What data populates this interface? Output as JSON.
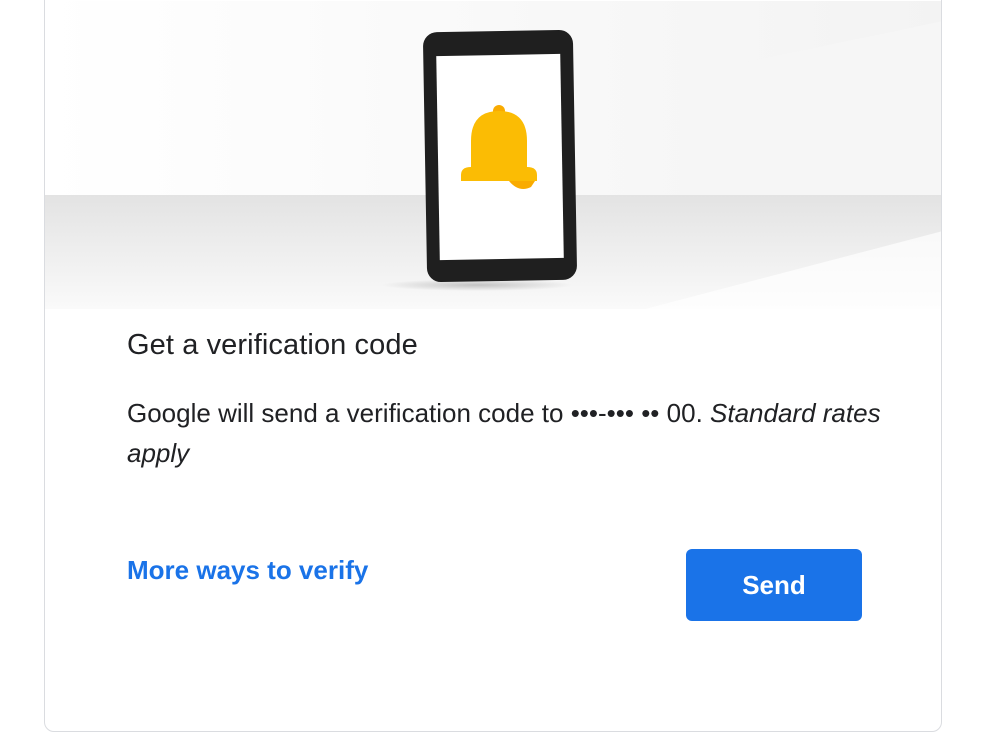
{
  "illustration": {
    "icon": "phone-with-bell",
    "bell_color": "#fbbc04",
    "phone_color": "#1f1f1f"
  },
  "prompt": {
    "title": "Get a verification code",
    "message_prefix": "Google will send a verification code to ",
    "masked_phone": "•••-••• •• 00",
    "message_period": ". ",
    "rates_note": "Standard rates apply"
  },
  "actions": {
    "more_ways_label": "More ways to verify",
    "send_label": "Send"
  },
  "colors": {
    "accent": "#1a73e8",
    "text": "#202124",
    "border": "#dadce0"
  }
}
